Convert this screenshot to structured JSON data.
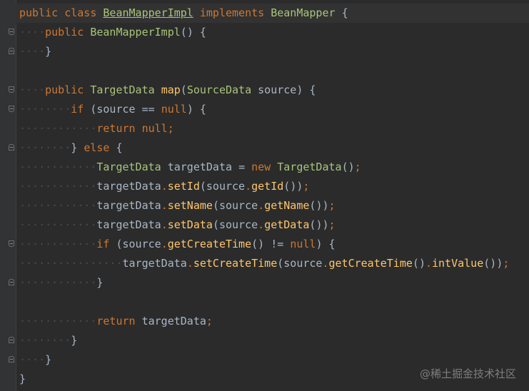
{
  "editor": {
    "lines": [
      {
        "indent": "",
        "text": "public class BeanMapperImpl implements BeanMapper {"
      },
      {
        "indent": "····",
        "text": "public BeanMapperImpl() {"
      },
      {
        "indent": "····",
        "text": "}"
      },
      {
        "indent": "",
        "text": ""
      },
      {
        "indent": "····",
        "text": "public TargetData map(SourceData source) {"
      },
      {
        "indent": "········",
        "text": "if (source == null) {"
      },
      {
        "indent": "············",
        "text": "return null;"
      },
      {
        "indent": "········",
        "text": "} else {"
      },
      {
        "indent": "············",
        "text": "TargetData targetData = new TargetData();"
      },
      {
        "indent": "············",
        "text": "targetData.setId(source.getId());"
      },
      {
        "indent": "············",
        "text": "targetData.setName(source.getName());"
      },
      {
        "indent": "············",
        "text": "targetData.setData(source.getData());"
      },
      {
        "indent": "············",
        "text": "if (source.getCreateTime() != null) {"
      },
      {
        "indent": "················",
        "text": "targetData.setCreateTime(source.getCreateTime().intValue());"
      },
      {
        "indent": "············",
        "text": "}"
      },
      {
        "indent": "",
        "text": ""
      },
      {
        "indent": "············",
        "text": "return targetData;"
      },
      {
        "indent": "········",
        "text": "}"
      },
      {
        "indent": "····",
        "text": "}"
      },
      {
        "indent": "",
        "text": "}"
      }
    ]
  },
  "watermark": "@稀土掘金技术社区",
  "colors": {
    "background": "#2b2b2b",
    "keyword": "#cc7832",
    "class_name": "#a9c47a",
    "method": "#ffc66d",
    "text": "#a9b7c6"
  }
}
